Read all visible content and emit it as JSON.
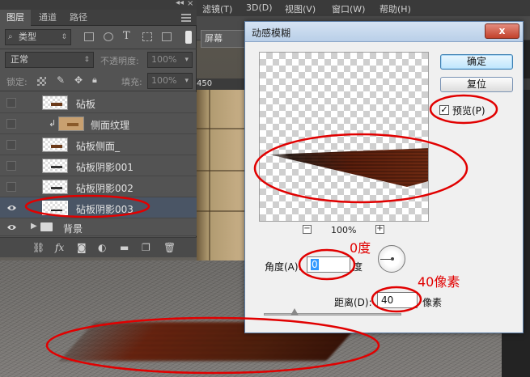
{
  "menubar": {
    "items": [
      "滤镜(T)",
      "3D(D)",
      "视图(V)",
      "窗口(W)",
      "帮助(H)"
    ]
  },
  "options_bar": {
    "button_label": "屏幕"
  },
  "ruler": {
    "tick_label": "450"
  },
  "layers_panel": {
    "tabs": [
      "图层",
      "通道",
      "路径"
    ],
    "active_tab": "图层",
    "filter_kind": "类型",
    "blend_mode": "正常",
    "opacity_label": "不透明度:",
    "opacity_value": "100%",
    "lock_label": "锁定:",
    "fill_label": "填充:",
    "fill_value": "100%",
    "layers": [
      {
        "name": "砧板",
        "visible": false,
        "selected": false,
        "type": "layer"
      },
      {
        "name": "侧面纹理",
        "visible": false,
        "selected": false,
        "type": "clipped"
      },
      {
        "name": "砧板侧面_",
        "visible": false,
        "selected": false,
        "type": "layer"
      },
      {
        "name": "砧板阴影001",
        "visible": false,
        "selected": false,
        "type": "layer"
      },
      {
        "name": "砧板阴影002",
        "visible": false,
        "selected": false,
        "type": "layer"
      },
      {
        "name": "砧板阴影003",
        "visible": true,
        "selected": true,
        "type": "layer"
      },
      {
        "name": "背景",
        "visible": true,
        "selected": false,
        "type": "group"
      }
    ]
  },
  "dialog": {
    "title": "动感模糊",
    "close_label": "x",
    "ok_label": "确定",
    "reset_label": "复位",
    "preview_checked": true,
    "preview_label": "预览(P)",
    "zoom_value": "100%",
    "zoom_minus": "−",
    "zoom_plus": "+",
    "angle_label": "角度(A):",
    "angle_value": "0",
    "angle_unit": "度",
    "distance_label": "距离(D):",
    "distance_value": "40",
    "distance_unit": "像素"
  },
  "annotations": {
    "angle_note": "0度",
    "distance_note": "40像素"
  },
  "colors": {
    "annotation": "#e10000",
    "wood_dark": "#3a1408",
    "wood_mid": "#6a2410"
  }
}
